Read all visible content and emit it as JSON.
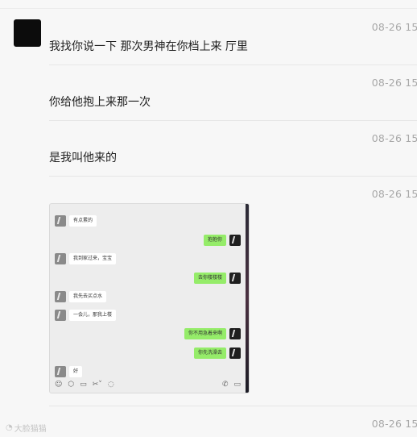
{
  "messages": [
    {
      "timestamp": "08-26 15:",
      "text": "我找你说一下 那次男神在你档上来 厅里"
    },
    {
      "timestamp": "08-26 15:",
      "text": "你给他抱上来那一次"
    },
    {
      "timestamp": "08-26 15:",
      "text": "是我叫他来的"
    },
    {
      "timestamp": "08-26 15:"
    },
    {
      "timestamp": "08-26 15:"
    }
  ],
  "screenshot_chat": [
    {
      "side": "left",
      "text": "有点累的"
    },
    {
      "side": "right",
      "text": "抱抱你"
    },
    {
      "side": "left",
      "text": "我到家过来，宝宝"
    },
    {
      "side": "right",
      "text": "去你楼楼楼"
    },
    {
      "side": "left",
      "text": "我先去买点水"
    },
    {
      "side": "left",
      "text": "一会儿，那我上楼"
    },
    {
      "side": "right",
      "text": "你不用急着来啊"
    },
    {
      "side": "right",
      "text": "你先洗澡去"
    },
    {
      "side": "left",
      "text": "好"
    }
  ],
  "toolbar_icons": [
    "emoji-icon",
    "sticker-icon",
    "folder-icon",
    "scissors-icon",
    "chat-bubble-icon",
    "phone-icon",
    "video-call-icon"
  ],
  "watermark": "大脸猫猫",
  "colors": {
    "background": "#f7f7f7",
    "bubble_green": "#95ec69",
    "timestamp": "#a8a8a8"
  }
}
